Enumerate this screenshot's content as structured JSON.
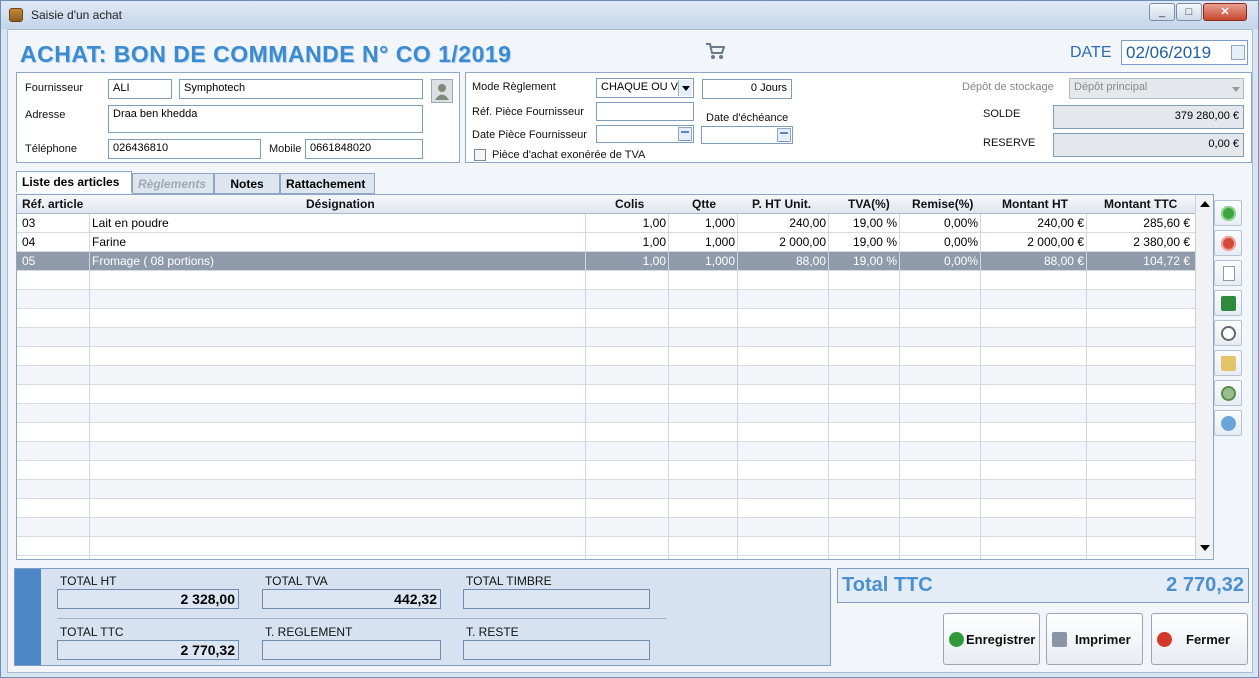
{
  "window": {
    "title": "Saisie d'un achat",
    "controls": [
      "_",
      "□",
      "✕"
    ]
  },
  "header": {
    "doc_title": "ACHAT: BON DE COMMANDE N° CO 1/2019",
    "date_label": "DATE",
    "date_value": "02/06/2019"
  },
  "supplier": {
    "fournisseur_label": "Fournisseur",
    "fournisseur_code": "ALI",
    "fournisseur_name": "Symphotech",
    "adresse_label": "Adresse",
    "adresse_value": "Draa ben khedda",
    "telephone_label": "Téléphone",
    "telephone_value": "026436810",
    "mobile_label": "Mobile",
    "mobile_value": "0661848020"
  },
  "payment": {
    "mode_label": "Mode Règlement",
    "mode_value": "CHAQUE OU V",
    "jours_value": "0 Jours",
    "ref_piece_label": "Réf. Pièce Fournisseur",
    "ref_piece_value": "",
    "date_echeance_label": "Date d'échéance",
    "date_piece_label": "Date Pièce Fournisseur",
    "date_piece_value": "",
    "date_echeance_value": "",
    "exoneree_label": "Pièce d'achat exonérée de TVA"
  },
  "stock": {
    "depot_label": "Dépôt de stockage",
    "depot_value": "Dépôt principal",
    "solde_label": "SOLDE",
    "solde_value": "379 280,00 €",
    "reserve_label": "RESERVE",
    "reserve_value": "0,00 €"
  },
  "tabs": [
    {
      "label": "Liste des articles",
      "active": true
    },
    {
      "label": "Règlements",
      "disabled": true
    },
    {
      "label": "Notes"
    },
    {
      "label": "Rattachement"
    }
  ],
  "grid": {
    "columns": [
      "Réf. article",
      "Désignation",
      "Colis",
      "Qtte",
      "P. HT Unit.",
      "TVA(%)",
      "Remise(%)",
      "Montant HT",
      "Montant TTC"
    ],
    "rows": [
      {
        "ref": "03",
        "designation": "Lait en poudre",
        "colis": "1,00",
        "qtte": "1,000",
        "pu": "240,00",
        "tva": "19,00 %",
        "remise": "0,00%",
        "mht": "240,00 €",
        "mttc": "285,60 €"
      },
      {
        "ref": "04",
        "designation": "Farine",
        "colis": "1,00",
        "qtte": "1,000",
        "pu": "2 000,00",
        "tva": "19,00 %",
        "remise": "0,00%",
        "mht": "2 000,00 €",
        "mttc": "2 380,00 €"
      },
      {
        "ref": "05",
        "designation": "Fromage ( 08 portions)",
        "colis": "1,00",
        "qtte": "1,000",
        "pu": "88,00",
        "tva": "19,00 %",
        "remise": "0,00%",
        "mht": "88,00 €",
        "mttc": "104,72 €"
      }
    ]
  },
  "side_tools": [
    "add-icon",
    "remove-icon",
    "new-document-icon",
    "excel-icon",
    "search-icon",
    "edit-icon",
    "target-icon",
    "refresh-icon"
  ],
  "totals": {
    "total_ht_label": "TOTAL HT",
    "total_ht_value": "2 328,00",
    "total_tva_label": "TOTAL  TVA",
    "total_tva_value": "442,32",
    "total_timbre_label": "TOTAL TIMBRE",
    "total_timbre_value": "",
    "total_ttc_label": "TOTAL TTC",
    "total_ttc_value": "2 770,32",
    "t_reglement_label": "T. REGLEMENT",
    "t_reglement_value": "",
    "t_reste_label": "T. RESTE",
    "t_reste_value": ""
  },
  "big_total": {
    "label": "Total TTC",
    "value": "2 770,32"
  },
  "actions": {
    "save": "Enregistrer",
    "print": "Imprimer",
    "close": "Fermer"
  },
  "colors": {
    "accent": "#3c8bd0",
    "selected_row": "#8f9bab",
    "stripe": "#4c86c6"
  }
}
